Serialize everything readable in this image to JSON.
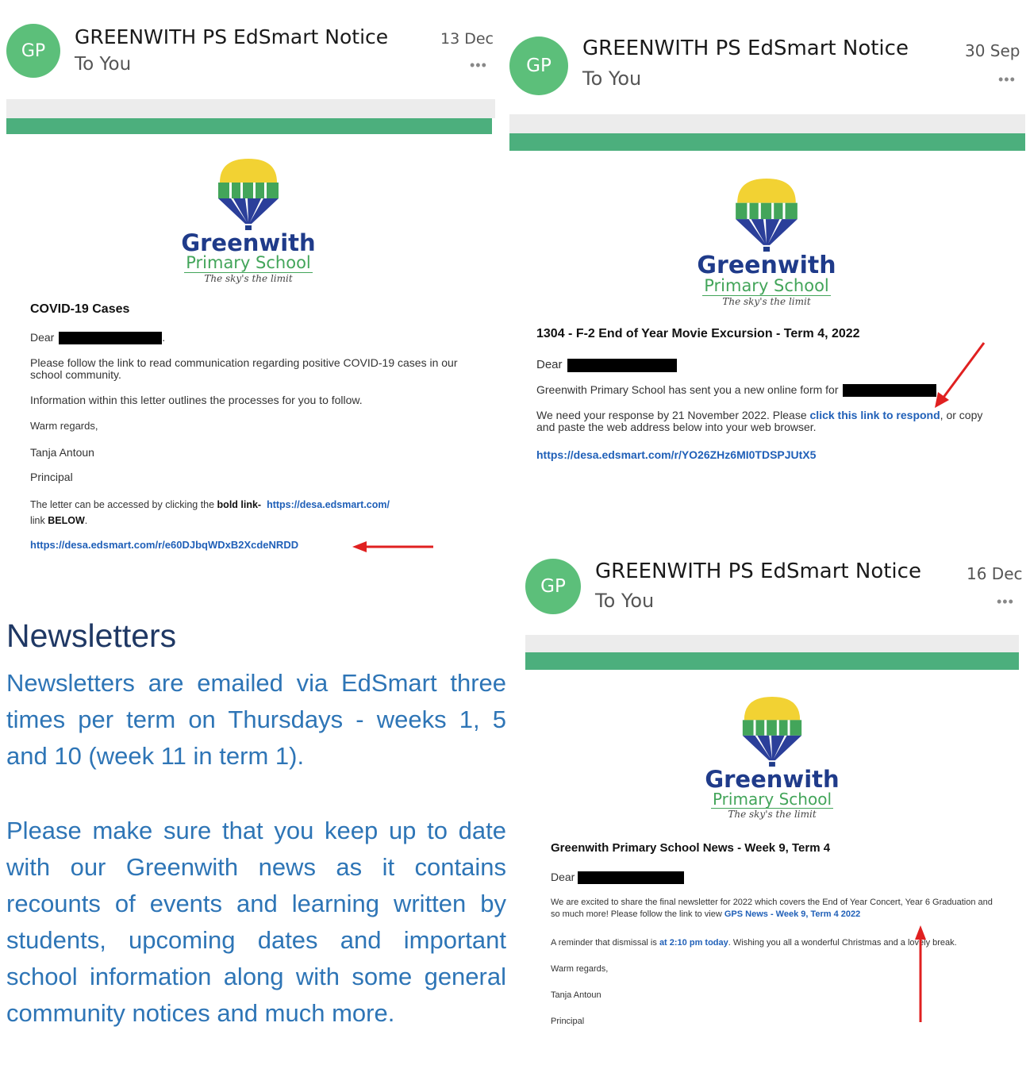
{
  "emails": [
    {
      "avatar": "GP",
      "sender": "GREENWITH PS EdSmart Notice",
      "to": "To You",
      "date": "13 Dec",
      "more": "...",
      "logo": {
        "line1": "Greenwith",
        "line2": "Primary School",
        "tagline": "The sky's the limit"
      },
      "subject": "COVID-19 Cases",
      "dear": "Dear",
      "p1": "Please follow the link to read communication regarding positive COVID-19 cases in our school community.",
      "p2": "Information within this letter outlines the processes for you to follow.",
      "regards": "Warm regards,",
      "name": "Tanja Antoun",
      "role": "Principal",
      "p3_pre": "The letter can be accessed by clicking the ",
      "p3_bold": "bold link-",
      "p3_link": "https://desa.edsmart.com/",
      "p3_post_a": "link ",
      "p3_post_b": "BELOW",
      "p3_post_c": ".",
      "main_link": "https://desa.edsmart.com/r/e60DJbqWDxB2XcdeNRDD"
    },
    {
      "avatar": "GP",
      "sender": "GREENWITH PS EdSmart Notice",
      "to": "To You",
      "date": "30 Sep",
      "more": "...",
      "logo": {
        "line1": "Greenwith",
        "line2": "Primary School",
        "tagline": "The sky's the limit"
      },
      "subject": "1304 - F-2 End of Year Movie Excursion - Term 4, 2022",
      "dear": "Dear",
      "p1": "Greenwith Primary School has sent you a new online form for",
      "p2_pre": "We need your response by 21 November 2022. Please ",
      "p2_link": "click this link to respond",
      "p2_post": ", or copy and paste the web address below into your web browser.",
      "main_link": "https://desa.edsmart.com/r/YO26ZHz6MI0TDSPJUtX5"
    },
    {
      "avatar": "GP",
      "sender": "GREENWITH PS EdSmart Notice",
      "to": "To You",
      "date": "16 Dec",
      "more": "...",
      "logo": {
        "line1": "Greenwith",
        "line2": "Primary School",
        "tagline": "The sky's the limit"
      },
      "subject": "Greenwith Primary School News - Week 9, Term 4",
      "dear": "Dear",
      "p1_pre": "We are excited to share the final newsletter for 2022 which covers the End of Year Concert, Year 6 Graduation and so much more! Please follow the link to view ",
      "p1_link": "GPS News - Week 9, Term 4 2022",
      "p2_pre": "A reminder that dismissal is ",
      "p2_link": "at 2:10 pm today",
      "p2_post": ". Wishing you all a wonderful Christmas and a lovely break.",
      "regards": "Warm regards,",
      "name": "Tanja Antoun",
      "role": "Principal"
    }
  ],
  "newsletters": {
    "title": "Newsletters",
    "para1": "Newsletters are emailed via EdSmart three times per term on Thursdays - weeks 1, 5 and 10 (week 11 in term 1).",
    "para2": "Please make sure that you keep up to date with our Greenwith news as it contains recounts of events and learning written by students, upcoming dates and important school information along with some general community notices and much more."
  },
  "colors": {
    "accent_green": "#4caf7d",
    "avatar_green": "#5cbf7a",
    "link_blue": "#2060b8",
    "arrow_red": "#e02020",
    "heading_navy": "#1f3864",
    "body_blue": "#2e75b6"
  }
}
